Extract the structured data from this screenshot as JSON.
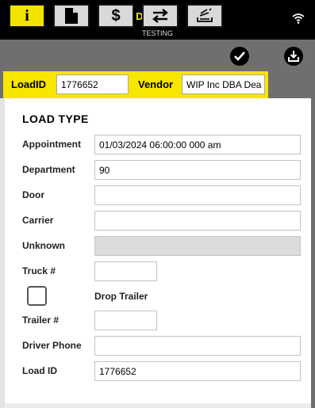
{
  "header": {
    "title": "DETAILS",
    "subtitle": "TESTING",
    "menu_icon": "hamburger-menu-icon",
    "status_icon": "wifi-icon"
  },
  "toolbar": {
    "buttons": [
      {
        "name": "info",
        "icon": "info-icon",
        "label": "i",
        "active": true
      },
      {
        "name": "document",
        "icon": "document-icon",
        "active": false
      },
      {
        "name": "charges",
        "icon": "dollar-icon",
        "label": "$",
        "active": false
      },
      {
        "name": "transfer",
        "icon": "swap-arrows-icon",
        "active": false
      },
      {
        "name": "stack",
        "icon": "stack-signature-icon",
        "active": false
      }
    ],
    "check_icon": "checkmark-circle-icon",
    "download_icon": "download-tray-icon"
  },
  "idbar": {
    "load_id_label": "LoadID",
    "load_id_value": "1776652",
    "vendor_label": "Vendor",
    "vendor_value": "WIP Inc DBA Dea"
  },
  "form": {
    "section_title": "LOAD TYPE",
    "appointment_label": "Appointment",
    "appointment_value": "01/03/2024 06:00:00 000 am",
    "department_label": "Department",
    "department_value": "90",
    "door_label": "Door",
    "door_value": "",
    "carrier_label": "Carrier",
    "carrier_value": "",
    "unknown_label": "Unknown",
    "unknown_value": "",
    "truck_label": "Truck #",
    "truck_value": "",
    "drop_trailer_label": "Drop Trailer",
    "drop_trailer_checked": false,
    "trailer_label": "Trailer #",
    "trailer_value": "",
    "driver_phone_label": "Driver Phone",
    "driver_phone_value": "",
    "load_id_label": "Load ID",
    "load_id_value": "1776652"
  },
  "colors": {
    "accent_yellow": "#f7e600",
    "header_bg": "#000000",
    "toolbar_bg": "#6f6f6f"
  }
}
